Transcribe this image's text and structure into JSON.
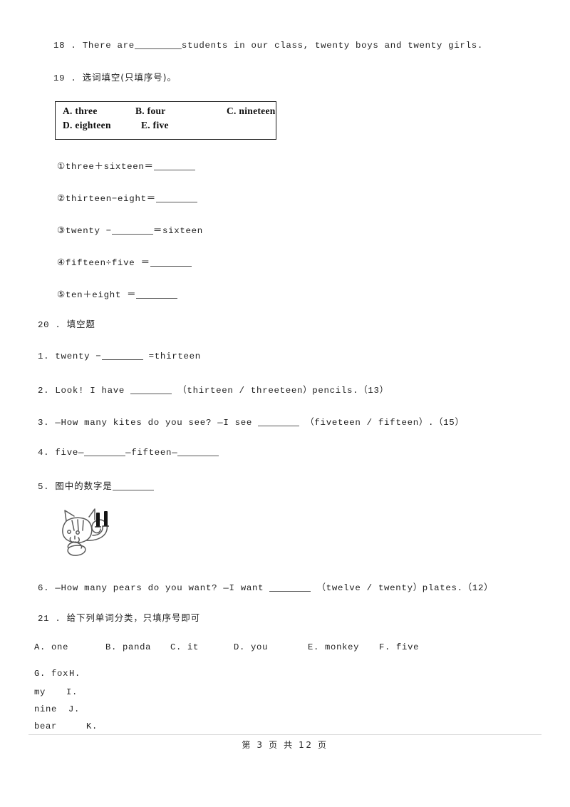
{
  "question_18": {
    "number": "18 .",
    "text_before": "There are",
    "text_after": "students in our class, twenty boys and twenty girls."
  },
  "question_19": {
    "number": "19 .",
    "prompt": "选词填空(只填序号)。",
    "options_box": {
      "row1": [
        "A. three",
        "B. four",
        "C. nineteen"
      ],
      "row2": [
        "D. eighteen",
        "E. five"
      ]
    },
    "sub_items": [
      {
        "marker": "①",
        "before": "three＋sixteen＝",
        "after": ""
      },
      {
        "marker": "②",
        "before": "thirteen−eight＝",
        "after": ""
      },
      {
        "marker": "③",
        "before": "twenty −",
        "after": "＝sixteen"
      },
      {
        "marker": "④",
        "before": "fifteen÷five ＝",
        "after": ""
      },
      {
        "marker": "⑤",
        "before": "ten＋eight ＝",
        "after": ""
      }
    ]
  },
  "question_20": {
    "number": "20 .",
    "prompt": "填空题",
    "items": [
      {
        "number": "1.",
        "before": "twenty −",
        "after": "=thirteen"
      },
      {
        "number": "2.",
        "before": "Look! I have",
        "after": "（thirteen / threeteen）pencils.（13）"
      },
      {
        "number": "3.",
        "before": "—How many kites do you see? —I see",
        "after": "（fiveteen / fifteen）.（15）"
      },
      {
        "number": "4.",
        "before": "five—",
        "middle": "—fifteen—",
        "after": ""
      },
      {
        "number": "5.",
        "before": "图中的数字是",
        "after": ""
      },
      {
        "number": "6.",
        "before": "—How many pears do you want? —I want",
        "after": "（twelve / twenty）plates.（12）"
      }
    ],
    "picture_alt": "squirrel with number 11"
  },
  "question_21": {
    "number": "21 .",
    "prompt": "给下列单词分类，只填序号即可",
    "word_lines": [
      [
        "A. one",
        "B. panda",
        "C. it",
        "D. you",
        "E. monkey",
        "F. five"
      ],
      [
        "G. fox",
        "H."
      ],
      [
        "my",
        "I."
      ],
      [
        "nine",
        "J."
      ],
      [
        "bear",
        "K."
      ]
    ]
  },
  "footer": {
    "text": "第 3 页 共 12 页"
  }
}
